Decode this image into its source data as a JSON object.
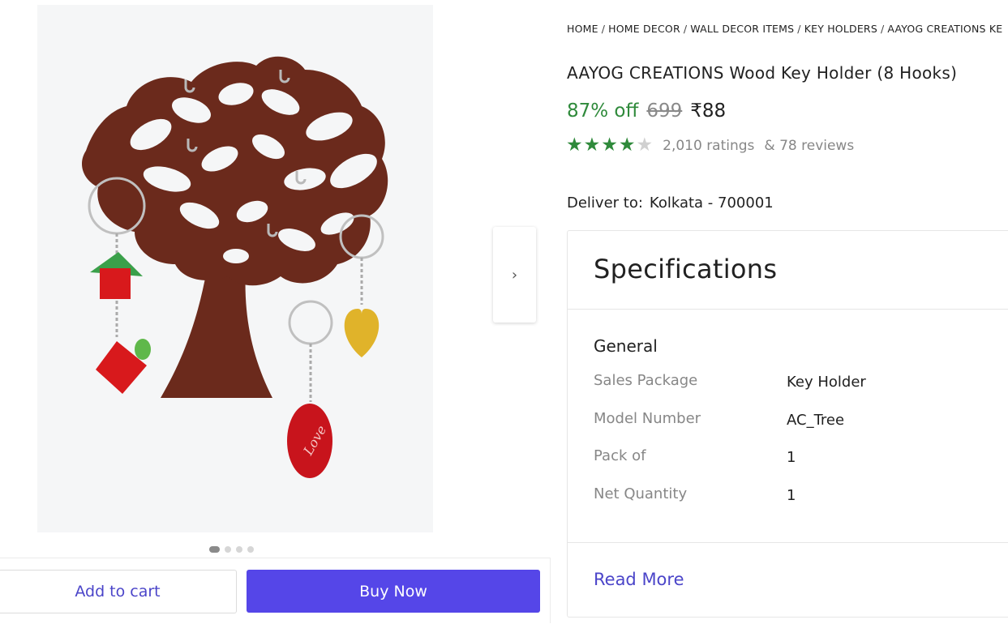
{
  "breadcrumb": [
    "HOME",
    "HOME DECOR",
    "WALL DECOR ITEMS",
    "KEY HOLDERS",
    "AAYOG CREATIONS KE"
  ],
  "product": {
    "title": "AAYOG CREATIONS Wood Key Holder (8 Hooks)",
    "discount": "87% off",
    "mrp": "699",
    "price": "₹88",
    "rating": {
      "value": 4,
      "max": 5
    },
    "ratings_text": "2,010 ratings",
    "reviews_text": "& 78 reviews"
  },
  "delivery": {
    "label": "Deliver to:",
    "location": "Kolkata - 700001"
  },
  "specifications": {
    "title": "Specifications",
    "section": "General",
    "rows": [
      {
        "key": "Sales Package",
        "value": "Key Holder"
      },
      {
        "key": "Model Number",
        "value": "AC_Tree"
      },
      {
        "key": "Pack of",
        "value": "1"
      },
      {
        "key": "Net Quantity",
        "value": "1"
      }
    ],
    "read_more": "Read More"
  },
  "gallery": {
    "next_icon": "chevron-right-icon",
    "next_glyph": "›",
    "dots": 4,
    "active_dot": 0,
    "love_text": "Love"
  },
  "actions": {
    "add_to_cart": "Add to cart",
    "buy_now": "Buy Now"
  },
  "colors": {
    "accent": "#5546e8",
    "discount": "#2f8a3b",
    "wood": "#6b2a1c"
  }
}
